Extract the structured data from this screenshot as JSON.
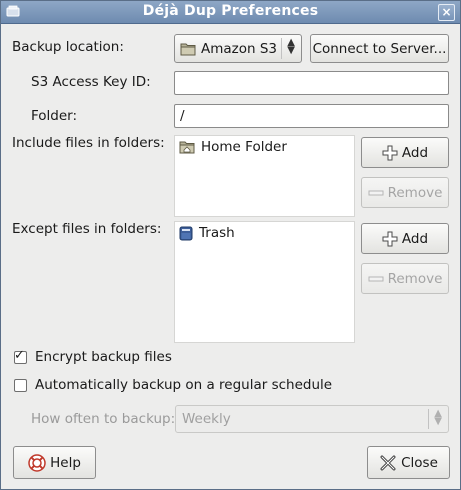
{
  "window": {
    "title": "Déjà Dup Preferences",
    "menu_icon": "window-menu-icon",
    "close_glyph": "×"
  },
  "backup_location": {
    "label": "Backup location:",
    "selected": "Amazon S3",
    "connect_button": "Connect to Server..."
  },
  "s3_key": {
    "label": "S3 Access Key ID:",
    "value": ""
  },
  "folder": {
    "label": "Folder:",
    "value": "/"
  },
  "include": {
    "label": "Include files in folders:",
    "items": [
      {
        "label": "Home Folder",
        "icon": "home-folder-icon"
      }
    ],
    "add_label": "Add",
    "remove_label": "Remove"
  },
  "exclude": {
    "label": "Except files in folders:",
    "items": [
      {
        "label": "Trash",
        "icon": "trash-icon"
      }
    ],
    "add_label": "Add",
    "remove_label": "Remove"
  },
  "encrypt": {
    "label": "Encrypt backup files",
    "checked": true
  },
  "schedule": {
    "label": "Automatically backup on a regular schedule",
    "checked": false
  },
  "frequency": {
    "label": "How often to backup:",
    "selected": "Weekly"
  },
  "footer": {
    "help_label": "Help",
    "close_label": "Close"
  },
  "colors": {
    "titlebar": "#7a95b8",
    "window_bg": "#ededec"
  }
}
